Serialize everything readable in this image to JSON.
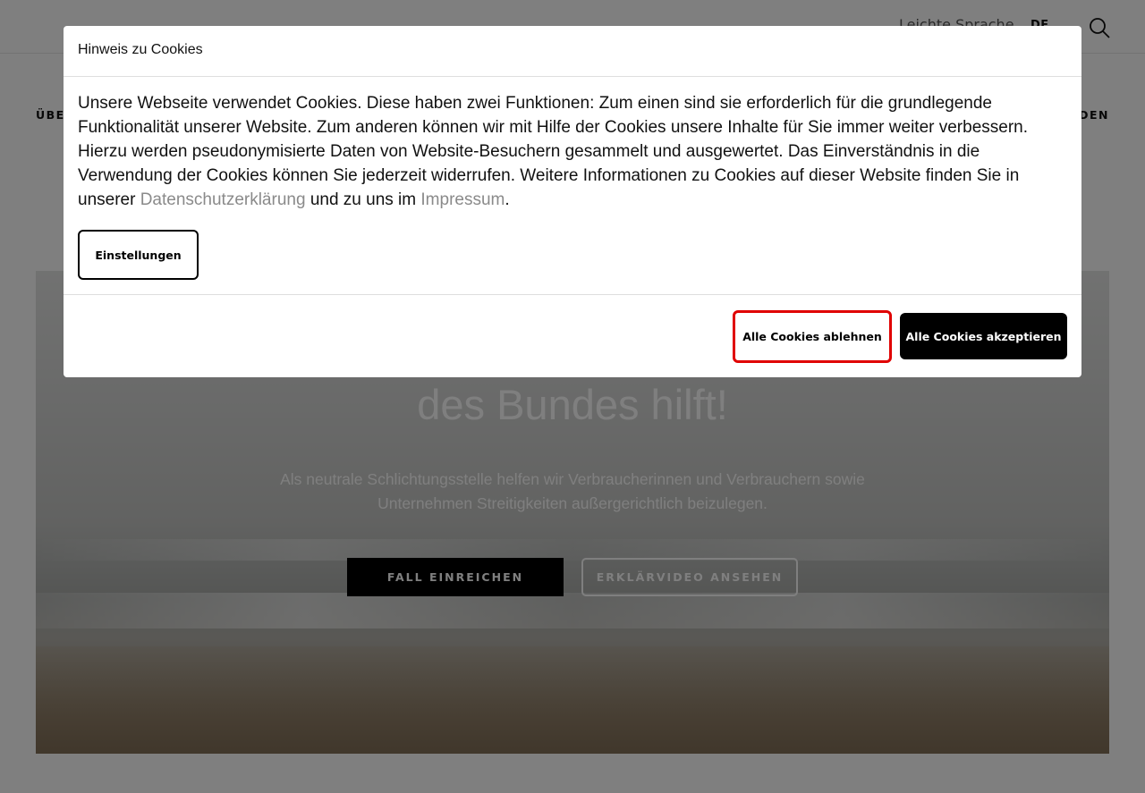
{
  "header": {
    "easy_language": "Leichte Sprache",
    "language": "DE",
    "language_chevron": "⌄",
    "search_icon": "search-icon"
  },
  "nav": {
    "left_item": "ÜBER",
    "right_item": "DEN"
  },
  "hero": {
    "title": "des Bundes hilft!",
    "subtitle": "Als neutrale Schlichtungsstelle helfen wir Verbraucherinnen und Verbrauchern sowie Unternehmen Streitigkeiten außergerichtlich beizulegen.",
    "submit_case_button": "FALL EINREICHEN",
    "explainer_video_button": "ERKLÄRVIDEO ANSEHEN"
  },
  "cookie_modal": {
    "title": "Hinweis zu Cookies",
    "body_text": "Unsere Webseite verwendet Cookies. Diese haben zwei Funktionen: Zum einen sind sie erforderlich für die grundlegende Funktionalität unserer Website. Zum anderen können wir mit Hilfe der Cookies unsere Inhalte für Sie immer weiter verbessern. Hierzu werden pseudonymisierte Daten von Website-Besuchern gesammelt und ausgewertet. Das Einverständnis in die Verwendung der Cookies können Sie jederzeit widerrufen. Weitere Informationen zu Cookies auf dieser Website finden Sie in unserer",
    "privacy_link": "Datenschutzerklärung",
    "connector_text": "und zu uns im",
    "imprint_link": "Impressum",
    "end_punct": ".",
    "settings_button": "Einstellungen",
    "reject_button": "Alle Cookies ablehnen",
    "accept_button": "Alle Cookies akzeptieren"
  },
  "colors": {
    "overlay": "rgba(0,0,0,0.5)",
    "link": "#8a8a8a",
    "highlight": "#e00000",
    "button_dark": "#000000"
  }
}
